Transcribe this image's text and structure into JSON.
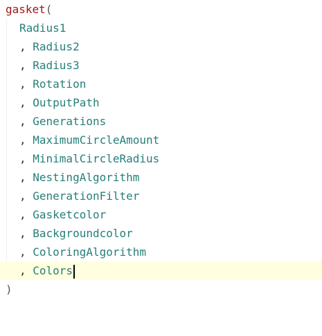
{
  "editor": {
    "function_name": "gasket",
    "open_paren": "(",
    "close_paren": ")",
    "separator": ", ",
    "first_param": "Radius1",
    "params": [
      "Radius2",
      "Radius3",
      "Rotation",
      "OutputPath",
      "Generations",
      "MaximumCircleAmount",
      "MinimalCircleRadius",
      "NestingAlgorithm",
      "GenerationFilter",
      "Gasketcolor",
      "Backgroundcolor",
      "ColoringAlgorithm",
      "Colors"
    ],
    "colors": {
      "function": "#a31515",
      "parameter": "#267f79",
      "current_line": "#ffffe0"
    }
  }
}
